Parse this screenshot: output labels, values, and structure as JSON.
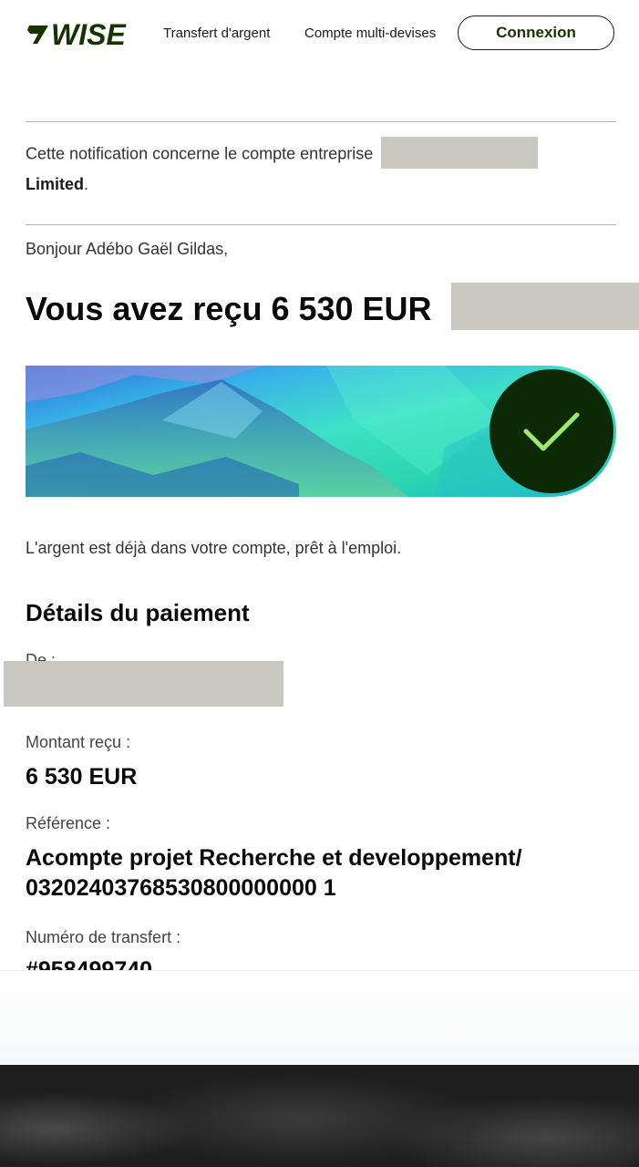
{
  "header": {
    "logo_text": "WISE",
    "nav": [
      "Transfert d'argent",
      "Compte multi-devises"
    ],
    "login_label": "Connexion"
  },
  "notification": {
    "prefix": "Cette notification concerne le compte entreprise",
    "company_suffix": "Limited",
    "period": "."
  },
  "greeting": "Bonjour Adébo Gaël Gildas,",
  "title": "Vous avez reçu 6 530 EUR",
  "banner": {
    "icon": "checkmark-icon",
    "accent": "#9fe870",
    "circle": "#0c2a06"
  },
  "ready_text": "L'argent est déjà dans votre compte, prêt à l'emploi.",
  "details": {
    "title": "Détails du paiement",
    "from_label": "De :",
    "amount_label": "Montant reçu :",
    "amount_value": "6 530 EUR",
    "reference_label": "Référence :",
    "reference_value": "Acompte projet Recherche et developpement/ 03202403768530800000000 1",
    "transfer_label": "Numéro de transfert :",
    "transfer_value": "#958499740"
  },
  "colors": {
    "brand": "#163300",
    "redaction": "#c8c7c2"
  }
}
